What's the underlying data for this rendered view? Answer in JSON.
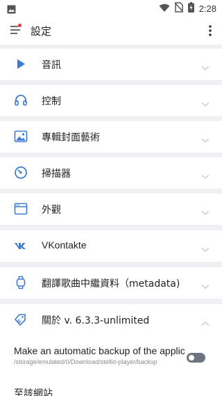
{
  "status_bar": {
    "time": "2:28",
    "icons": [
      "image-icon",
      "wifi-icon",
      "no-sim-icon",
      "battery-charging-icon"
    ]
  },
  "app_bar": {
    "title": "設定",
    "menu_icon": "menu-icon",
    "more_icon": "more-vertical-icon"
  },
  "sections": [
    {
      "label": "音訊",
      "icon": "play-icon"
    },
    {
      "label": "控制",
      "icon": "headphones-icon"
    },
    {
      "label": "專輯封面藝術",
      "icon": "image-icon"
    },
    {
      "label": "掃描器",
      "icon": "gauge-icon"
    },
    {
      "label": "外觀",
      "icon": "window-icon"
    },
    {
      "label": "VKontakte",
      "icon": "vk-icon"
    },
    {
      "label": "翻譯歌曲中繼資料（metadata)",
      "icon": "watch-icon"
    },
    {
      "label": "關於 v. 6.3.3-unlimited",
      "icon": "tags-icon",
      "expanded": true
    }
  ],
  "about": {
    "backup_title": "Make an automatic backup of the applic..",
    "backup_path": "/storage/emulated/0/Download/stellio-player/backup",
    "backup_enabled": false,
    "website_label": "至該網站"
  },
  "colors": {
    "accent": "#3a7bd5",
    "background": "#eef0f3",
    "surface": "#ffffff",
    "badge": "#e53935"
  }
}
